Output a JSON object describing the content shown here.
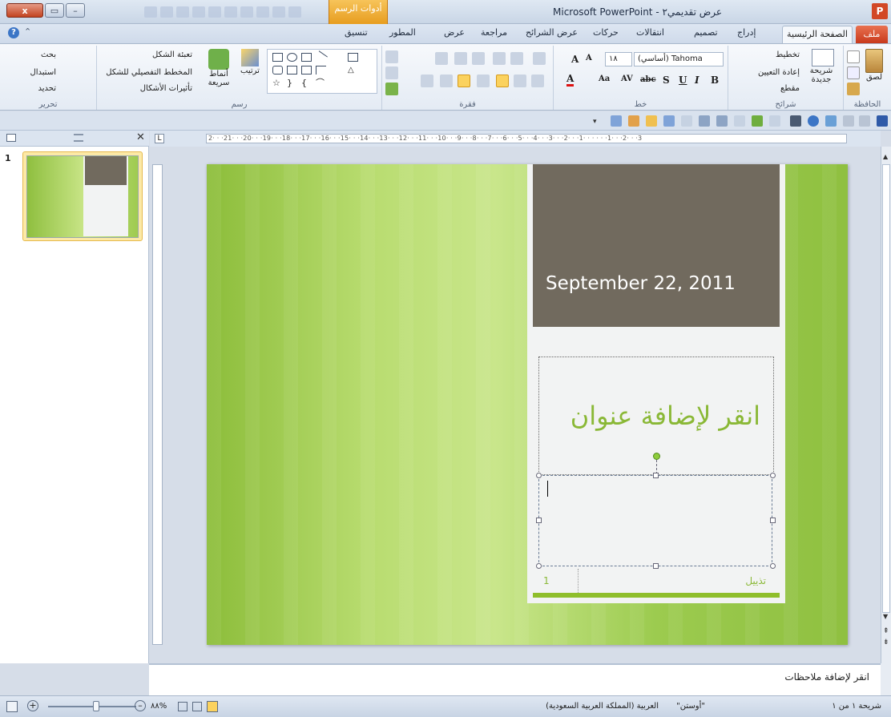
{
  "window": {
    "title": "عرض تقديمي٢ - Microsoft PowerPoint",
    "tools_tab": "أدوات الرسم",
    "logo": "P",
    "close": "x"
  },
  "tabs": {
    "file": "ملف",
    "home": "الصفحة الرئيسية",
    "insert": "إدراج",
    "design": "تصميم",
    "transitions": "انتقالات",
    "animations": "حركات",
    "slideshow": "عرض الشرائح",
    "review": "مراجعة",
    "view": "عرض",
    "developer": "المطور",
    "format": "تنسيق"
  },
  "ribbon": {
    "clipboard": {
      "label": "الحافظة",
      "paste": "لصق"
    },
    "slides": {
      "label": "شرائح",
      "new_slide": "شريحة جديدة",
      "layout": "تخطيط",
      "reset": "إعادة التعيين",
      "section": "مقطع"
    },
    "font": {
      "label": "خط",
      "name": "(أساسي) Tahoma",
      "size": "١٨",
      "bold": "B",
      "italic": "I",
      "underline": "U",
      "shadow": "S",
      "strike": "abc",
      "spacing": "AV",
      "case": "Aa",
      "color": "A",
      "grow": "A",
      "shrink": "A"
    },
    "paragraph": {
      "label": "فقرة"
    },
    "drawing": {
      "label": "رسم",
      "arrange": "ترتيب",
      "quick_styles": "أنماط سريعة",
      "fill": "تعبئة الشكل",
      "outline": "المخطط التفصيلي للشكل",
      "effects": "تأثيرات الأشكال"
    },
    "editing": {
      "label": "تحرير",
      "find": "بحث",
      "replace": "استبدال",
      "select": "تحديد"
    }
  },
  "ruler": {
    "marks": "2· · ·21· · ·20· · ·19· · ·18· · ·17· · ·16· · ·15· · ·14· · ·13· · ·12· · ·11· · ·10· · ·9· · ·8· · ·7· · ·6· · ·5· · ·4· · ·3· · ·2· · ·1· · · · · ·1· · ·2· · ·3"
  },
  "thumbnail": {
    "number": "1"
  },
  "slide": {
    "date": "September 22, 2011",
    "title_placeholder": "انقر لإضافة عنوان",
    "footer": "تذييل",
    "page_number": "1"
  },
  "notes": {
    "placeholder": "انقر لإضافة ملاحظات"
  },
  "status": {
    "slide_info": "شريحة ١ من ١",
    "theme": "\"أوستن\"",
    "language": "العربية (المملكة العربية السعودية)",
    "zoom": "%٨٨"
  },
  "colors": {
    "accent_green": "#8ab836",
    "date_box": "#716a5e",
    "file_tab": "#c8391b",
    "tools_tab": "#e79d1f"
  }
}
